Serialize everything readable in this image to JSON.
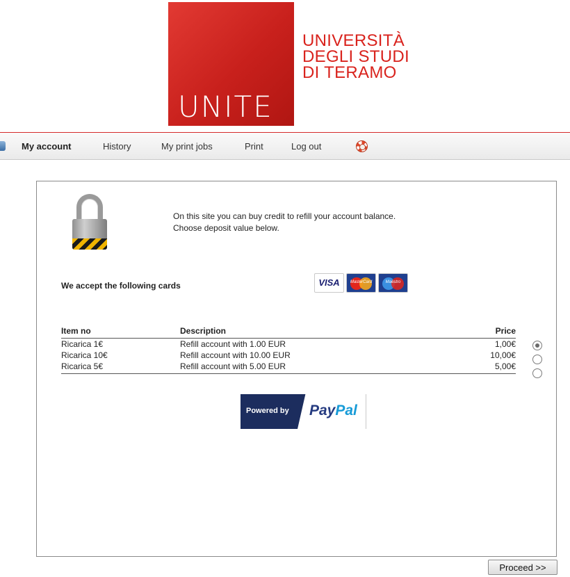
{
  "logo": {
    "mark": "UNITE",
    "lines": [
      "UNIVERSITÀ",
      "DEGLI STUDI",
      "DI TERAMO"
    ],
    "brand_red": "#d9231d"
  },
  "nav": {
    "items": [
      {
        "label": "My account",
        "active": true
      },
      {
        "label": "History",
        "active": false
      },
      {
        "label": "My print jobs",
        "active": false
      },
      {
        "label": "Print",
        "active": false
      },
      {
        "label": "Log out",
        "active": false
      }
    ],
    "help_icon": "lifebuoy-icon"
  },
  "intro": {
    "line1": "On this site you can buy credit to refill your account balance.",
    "line2": "Choose deposit value below."
  },
  "cards": {
    "label": "We accept the following cards",
    "brands": [
      "VISA",
      "MasterCard",
      "Maestro"
    ]
  },
  "table": {
    "headers": {
      "item": "Item no",
      "description": "Description",
      "price": "Price"
    },
    "rows": [
      {
        "item": "Ricarica 1€",
        "description": "Refill account with 1.00 EUR",
        "price": "1,00€",
        "selected": true
      },
      {
        "item": "Ricarica 10€",
        "description": "Refill account with 10.00 EUR",
        "price": "10,00€",
        "selected": false
      },
      {
        "item": "Ricarica 5€",
        "description": "Refill account with 5.00 EUR",
        "price": "5,00€",
        "selected": false
      }
    ]
  },
  "paypal": {
    "powered_by": "Powered by",
    "pay": "Pay",
    "pal": "Pal"
  },
  "actions": {
    "proceed_label": "Proceed >>"
  }
}
